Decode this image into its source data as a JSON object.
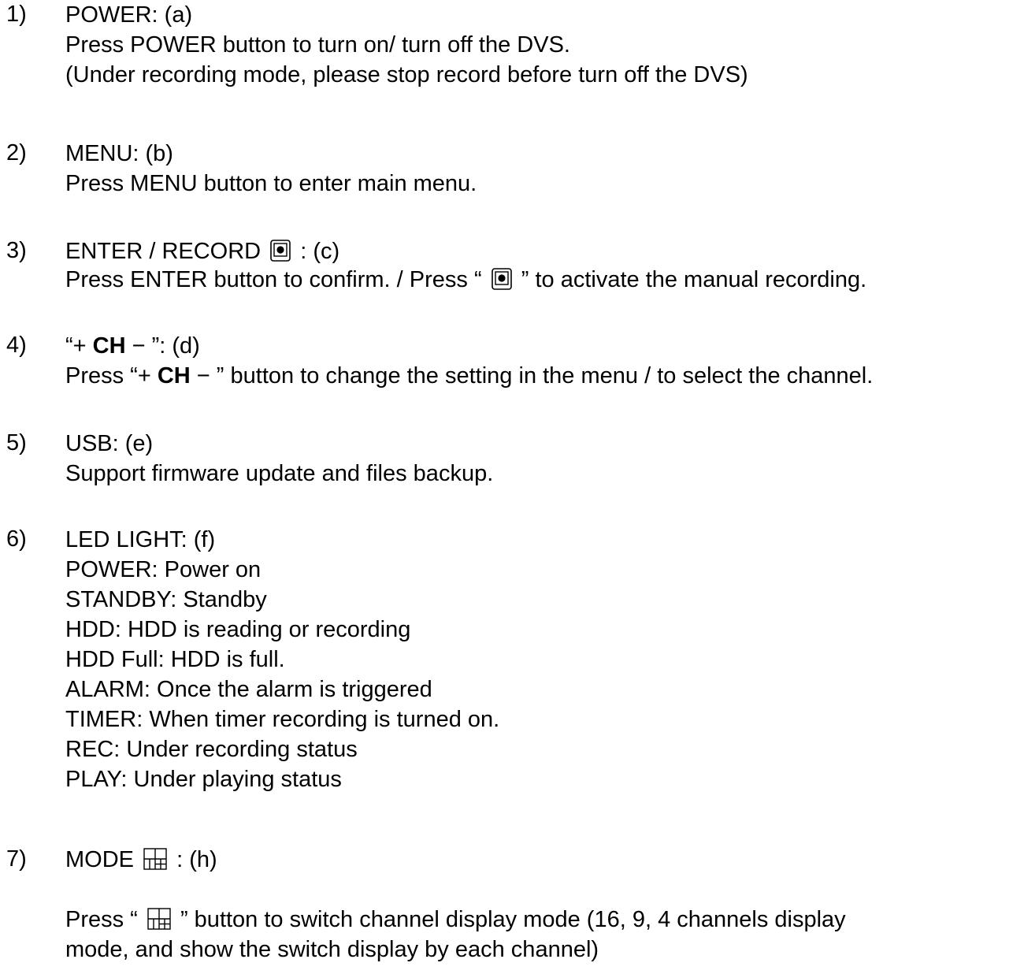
{
  "items": [
    {
      "num": "1)",
      "title": "POWER: (a)",
      "lines": [
        "Press POWER button to turn on/ turn off the DVS.",
        "(Under recording mode, please stop record before turn off the DVS)"
      ]
    },
    {
      "num": "2)",
      "title": "MENU: (b)",
      "lines": [
        "Press MENU button to enter main menu."
      ]
    },
    {
      "num": "3)",
      "title_a": "ENTER / RECORD",
      "title_b": " :  (c)",
      "line_a": "Press ENTER button to confirm. / Press “",
      "line_b": "” to activate the manual recording."
    },
    {
      "num": "4)",
      "open_quote": "“+ ",
      "ch": "CH",
      "close": " − ”:  (d)",
      "press": "Press “+ ",
      "rest": " − ” button to change the setting in the menu / to select the channel."
    },
    {
      "num": "5)",
      "title": "USB: (e)",
      "lines": [
        "Support firmware update and files backup."
      ]
    },
    {
      "num": "6)",
      "title": "LED LIGHT: (f)",
      "lines": [
        "POWER: Power on",
        "STANDBY: Standby",
        "HDD: HDD is reading or recording",
        "HDD Full: HDD is full.",
        "ALARM: Once the alarm is triggered",
        "TIMER: When timer recording is turned on.",
        "REC: Under recording status",
        "PLAY: Under playing status"
      ]
    },
    {
      "num": "7)",
      "title_a": "MODE",
      "title_b": " :  (h)",
      "line_a": "Press “",
      "line_b": "” button to switch channel display mode (16, 9, 4 channels display",
      "line_c": "mode, and show the switch display by each channel)"
    }
  ],
  "icons": {
    "record": "record-button-icon",
    "mode": "display-mode-grid-icon"
  }
}
